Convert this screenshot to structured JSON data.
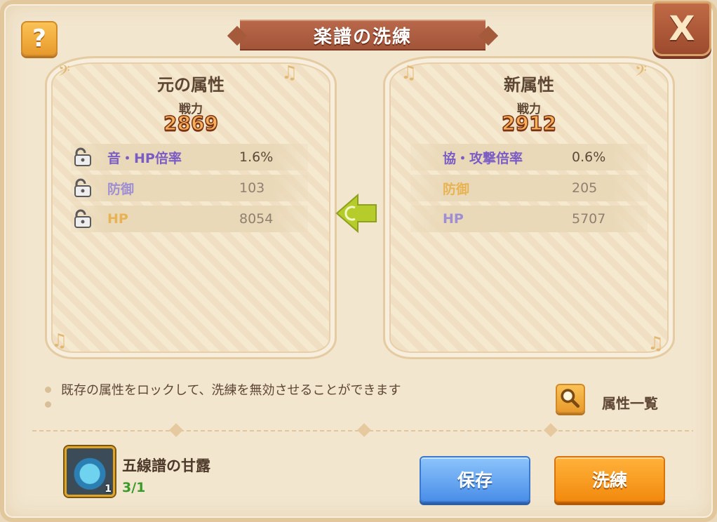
{
  "dialog": {
    "title": "楽譜の洗練",
    "help_label": "?",
    "close_label": "X"
  },
  "original": {
    "title": "元の属性",
    "power_label": "戦力",
    "power_value": "2869",
    "stats": [
      {
        "name": "音・HP倍率",
        "value": "1.6%"
      },
      {
        "name": "防御",
        "value": "103"
      },
      {
        "name": "HP",
        "value": "8054"
      }
    ]
  },
  "new": {
    "title": "新属性",
    "power_label": "戦力",
    "power_value": "2912",
    "stats": [
      {
        "name": "協・攻撃倍率",
        "value": "0.6%"
      },
      {
        "name": "防御",
        "value": "205"
      },
      {
        "name": "HP",
        "value": "5707"
      }
    ]
  },
  "info": {
    "line1": "既存の属性をロックして、洗練を無効させることができます",
    "attr_list_label": "属性一覧"
  },
  "material": {
    "name": "五線譜の甘露",
    "quantity": "3/1",
    "badge": "1"
  },
  "buttons": {
    "save": "保存",
    "refine": "洗練"
  },
  "colors": {
    "accent_orange": "#f28a0e",
    "accent_blue": "#4a8ee8",
    "ribbon": "#a35539"
  }
}
